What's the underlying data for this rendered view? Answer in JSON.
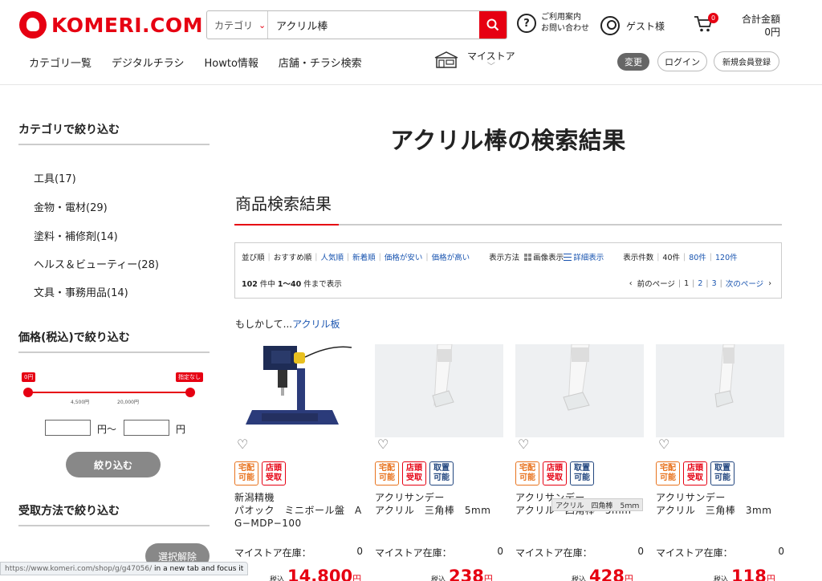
{
  "header": {
    "logo_text": "KOMERI.COM",
    "search_category": "カテゴリ",
    "search_value": "アクリル棒",
    "help_line1": "ご利用案内",
    "help_line2": "お問い合わせ",
    "guest": "ゲスト様",
    "cart_count": "0",
    "total_label": "合計金額",
    "total_value": "0円",
    "nav": [
      "カテゴリ一覧",
      "デジタルチラシ",
      "Howto情報",
      "店舗・チラシ検索"
    ],
    "mystore": "マイストア",
    "change": "変更",
    "login": "ログイン",
    "register": "新規会員登録"
  },
  "sidebar": {
    "category_heading": "カテゴリで絞り込む",
    "categories": [
      "工具(17)",
      "金物・電材(29)",
      "塗料・補修剤(14)",
      "ヘルス＆ビューティー(28)",
      "文具・事務用品(14)"
    ],
    "price_heading": "価格(税込)で絞り込む",
    "price_min_flag": "0円",
    "price_max_flag": "指定なし",
    "price_tick1": "4,500円",
    "price_tick2": "20,000円",
    "price_unit_from": "円〜",
    "price_unit_to": "円",
    "filter_button": "絞り込む",
    "receive_heading": "受取方法で絞り込む",
    "clear_button": "選択解除"
  },
  "main": {
    "page_title": "アクリル棒の検索結果",
    "section_title": "商品検索結果",
    "sort_label": "並び順",
    "sort_options": [
      "おすすめ順",
      "人気順",
      "新着順",
      "価格が安い",
      "価格が高い"
    ],
    "view_label": "表示方法",
    "view_image": "画像表示",
    "view_detail": "詳細表示",
    "per_page_label": "表示件数",
    "per_page": [
      "40件",
      "80件",
      "120件"
    ],
    "count_total": "102",
    "count_suffix": "件中",
    "count_range": "1〜40",
    "count_tail": "件まで表示",
    "prev_page": "前のページ",
    "pages": [
      "1",
      "2",
      "3"
    ],
    "next_page": "次のページ",
    "suggest_prefix": "もしかして...",
    "suggest_link": "アクリル板"
  },
  "badges": {
    "home": "宅配\n可能",
    "store": "店頭\n受取",
    "keep": "取置\n可能"
  },
  "products": [
    {
      "name": "新潟精機\nパオック　ミニボール盤　A\nG−MDP−100",
      "stock_label": "マイストア在庫：",
      "stock": "0",
      "tax_label": "税込",
      "price": "14,800",
      "yen": "円",
      "badges": [
        "home",
        "store"
      ]
    },
    {
      "name": "アクリサンデー\nアクリル　三角棒　5mm",
      "stock_label": "マイストア在庫：",
      "stock": "0",
      "tax_label": "税込",
      "price": "238",
      "yen": "円",
      "badges": [
        "home",
        "store",
        "keep"
      ]
    },
    {
      "name": "アクリサンデー\nアクリル　四角棒　5mm",
      "stock_label": "マイストア在庫：",
      "stock": "0",
      "tax_label": "税込",
      "price": "428",
      "yen": "円",
      "badges": [
        "home",
        "store",
        "keep"
      ]
    },
    {
      "name": "アクリサンデー\nアクリル　三角棒　3mm",
      "stock_label": "マイストア在庫：",
      "stock": "0",
      "tax_label": "税込",
      "price": "118",
      "yen": "円",
      "badges": [
        "home",
        "store",
        "keep"
      ]
    }
  ],
  "tooltip": "アクリル　四角棒　5ｍｍ",
  "status_bar": {
    "url": "https://www.komeri.com/shop/g/g47056/",
    "hint": "in a new tab and focus it"
  }
}
